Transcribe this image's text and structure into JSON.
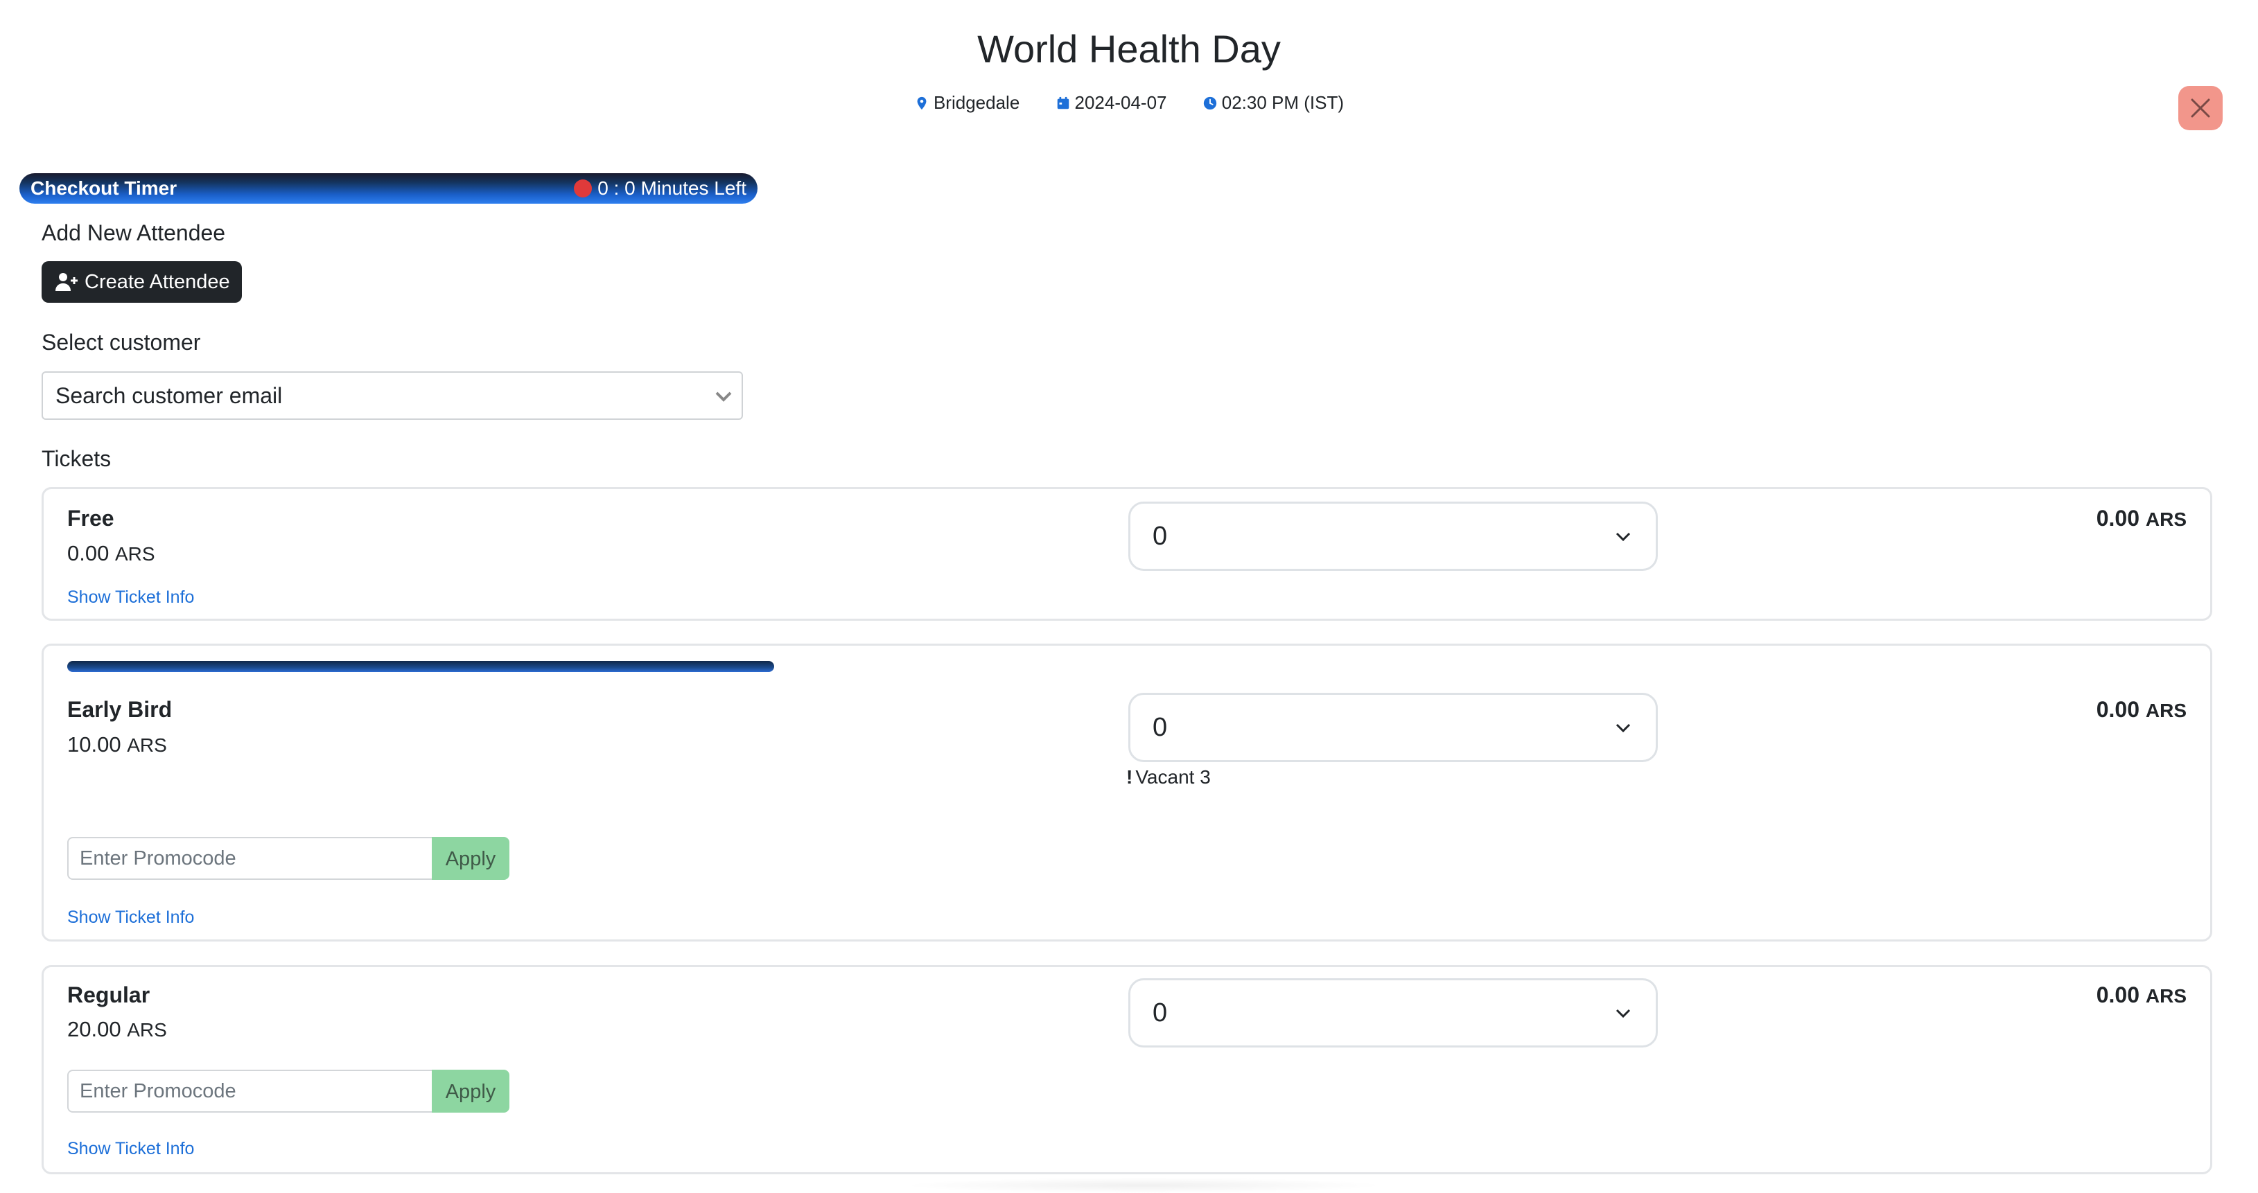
{
  "event": {
    "title": "World Health Day",
    "location": "Bridgedale",
    "date": "2024-04-07",
    "time": "02:30 PM (IST)"
  },
  "icons": {
    "location": "map-pin-icon",
    "date": "calendar-icon",
    "time": "clock-icon",
    "close": "close-icon",
    "create": "user-plus-icon",
    "dropdown": "chevron-down-icon"
  },
  "colors": {
    "accent": "#1d6fd8",
    "close_button": "#f2968b",
    "apply_button": "#8dd6a1",
    "dark_button": "#212529",
    "timer_dot": "#e03a3a"
  },
  "timer": {
    "label": "Checkout Timer",
    "remaining": "0 : 0 Minutes Left"
  },
  "attendee": {
    "section_label": "Add New Attendee",
    "create_button": "Create Attendee"
  },
  "customer": {
    "section_label": "Select customer",
    "placeholder": "Search customer email"
  },
  "tickets": {
    "section_label": "Tickets",
    "items": [
      {
        "name": "Free",
        "price": "0.00",
        "currency": "ARS",
        "quantity": "0",
        "total": "0.00",
        "total_currency": "ARS",
        "info_link": "Show Ticket Info"
      },
      {
        "name": "Early Bird",
        "price": "10.00",
        "currency": "ARS",
        "quantity": "0",
        "total": "0.00",
        "total_currency": "ARS",
        "vacant_mark": "!",
        "vacant_text": "Vacant 3",
        "promo_placeholder": "Enter Promocode",
        "apply_label": "Apply",
        "info_link": "Show Ticket Info"
      },
      {
        "name": "Regular",
        "price": "20.00",
        "currency": "ARS",
        "quantity": "0",
        "total": "0.00",
        "total_currency": "ARS",
        "promo_placeholder": "Enter Promocode",
        "apply_label": "Apply",
        "info_link": "Show Ticket Info"
      }
    ]
  }
}
